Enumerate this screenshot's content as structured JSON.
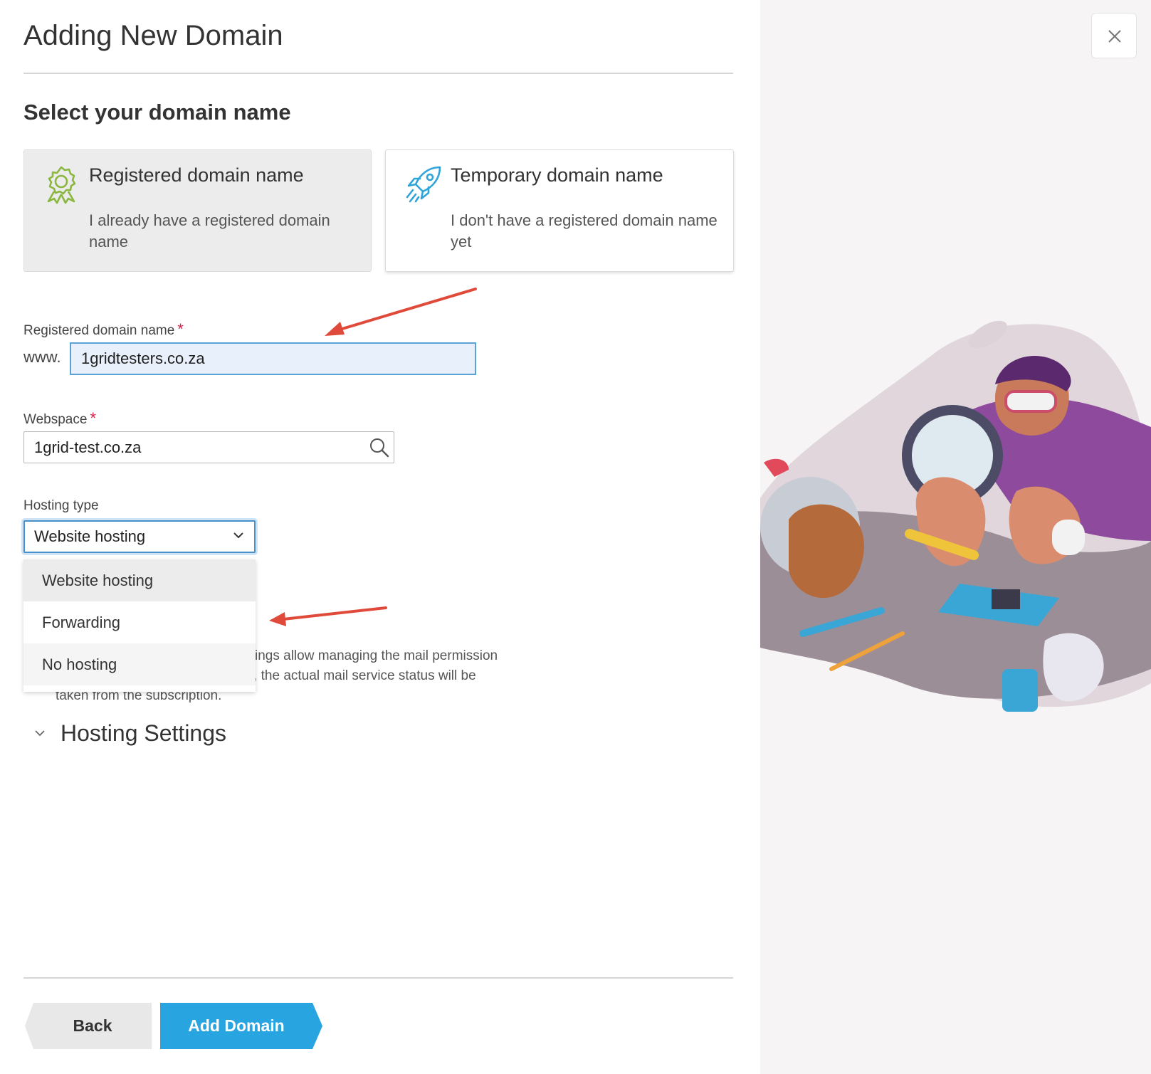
{
  "dialog": {
    "title": "Adding New Domain",
    "close_icon": "close-icon"
  },
  "domain_selection": {
    "heading": "Select your domain name",
    "options": [
      {
        "title": "Registered domain name",
        "description": "I already have a registered domain name",
        "icon": "award-badge-icon",
        "selected": true
      },
      {
        "title": "Temporary domain name",
        "description": "I don't have a registered domain name yet",
        "icon": "rocket-icon",
        "selected": false
      }
    ]
  },
  "form": {
    "domain_label": "Registered domain name",
    "required_mark": "*",
    "domain_prefix": "www.",
    "domain_value": "1gridtesters.co.za",
    "webspace_label": "Webspace",
    "webspace_value": "1grid-test.co.za",
    "hosting_type_label": "Hosting type",
    "hosting_type_value": "Website hosting",
    "hosting_type_options": [
      "Website hosting",
      "Forwarding",
      "No hosting"
    ],
    "note_lines": [
      "ings allow managing the mail permission",
      "v, the actual mail service status will be",
      "taken from the subscription."
    ]
  },
  "hosting_settings": {
    "title": "Hosting Settings"
  },
  "footer": {
    "back_label": "Back",
    "add_label": "Add Domain"
  },
  "colors": {
    "accent": "#28a4e0",
    "required": "#d6204b",
    "annotation_arrow": "#e04a3a",
    "icon_green": "#8bb73f",
    "icon_blue": "#2fa4d9"
  }
}
